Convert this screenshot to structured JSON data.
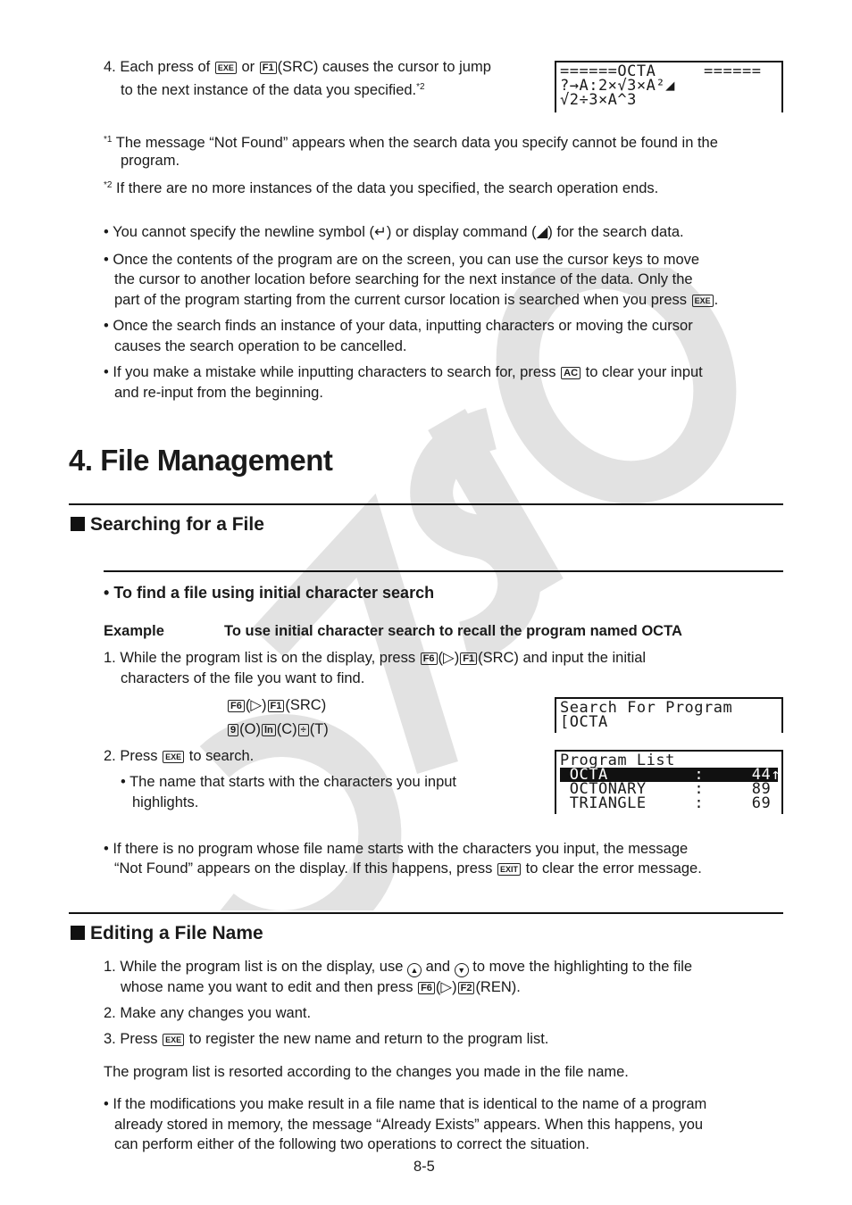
{
  "watermark": "CASIO",
  "top": {
    "step4": {
      "num": "4.",
      "pre": "Each press of",
      "key1": "EXE",
      "mid": "or",
      "key2": "F1",
      "post": "(SRC) causes the cursor to jump",
      "line2": "to the next instance of the data you specified.",
      "sup": "*2"
    },
    "screen1": {
      "rows": [
        "======OCTA     ======",
        "?→A:2×√3×A²◢",
        "√2÷3×A^3"
      ]
    },
    "footnotes": [
      {
        "mark": "*1",
        "line1": "The message “Not Found” appears when the search data you specify cannot be found in the",
        "line2": "program."
      },
      {
        "mark": "*2",
        "line1": "If there are no more instances of the data you specified, the search operation ends."
      }
    ],
    "bullets": [
      {
        "line1_pre": "You cannot specify the newline symbol (",
        "sym1": "↵",
        "line1_mid": ") or display command (",
        "sym2": "◢",
        "line1_post": ") for the search data."
      },
      {
        "line1": "Once the contents of the program are on the screen, you can use the cursor keys to move",
        "line2": "the cursor to another location before searching for the next instance of the data. Only the",
        "line3_pre": "part of the program starting from the current cursor location is searched when you press",
        "key": "EXE",
        "line3_post": "."
      },
      {
        "line1": "Once the search finds an instance of your data, inputting characters or moving the cursor",
        "line2": "causes the search operation to be cancelled."
      },
      {
        "line1_pre": "If you make a mistake while inputting characters to search for, press",
        "key": "AC",
        "line1_post": "to clear your input",
        "line2": "and re-input from the beginning."
      }
    ]
  },
  "section": {
    "title": "4. File Management",
    "searching": {
      "heading": "Searching for a File",
      "subheading": "To find a file using initial character search",
      "example_label": "Example",
      "example_text": "To use initial character search to recall the program named OCTA",
      "step1": {
        "num": "1.",
        "pre": "While the program list is on the display, press",
        "k1": "F6",
        "arrow": "(▷)",
        "k2": "F1",
        "post": "(SRC) and input the initial",
        "line2": "characters of the file you want to find."
      },
      "keyseq1": {
        "k1": "F6",
        "arrow": "(▷)",
        "k2": "F1",
        "label": "(SRC)"
      },
      "keyseq2": {
        "k1": "9",
        "l1": "(O)",
        "k2": "ln",
        "l2": "(C)",
        "k3": "÷",
        "l3": "(T)"
      },
      "screen2": {
        "rows": [
          "Search For Program",
          "[OCTA"
        ]
      },
      "step2": {
        "num": "2.",
        "pre": "Press",
        "key": "EXE",
        "post": "to search.",
        "sub1": "The name that starts with the characters you input",
        "sub2": "highlights."
      },
      "screen3": {
        "title": "Program List",
        "items": [
          {
            "name": "OCTA",
            "size": "44",
            "highlighted": true,
            "marker": "↑"
          },
          {
            "name": "OCTONARY",
            "size": "89",
            "highlighted": false
          },
          {
            "name": "TRIANGLE",
            "size": "69",
            "highlighted": false
          }
        ]
      },
      "note": {
        "line1": "If there is no program whose file name starts with the characters you input, the message",
        "line2_pre": "“Not Found” appears on the display. If this happens, press",
        "key": "EXIT",
        "line2_post": "to clear the error message."
      }
    },
    "editing": {
      "heading": "Editing a File Name",
      "step1": {
        "num": "1.",
        "pre": "While the program list is on the display, use",
        "up": "▲",
        "and": "and",
        "down": "▼",
        "post": "to move the highlighting to the file",
        "line2_pre": "whose name you want to edit and then press",
        "k1": "F6",
        "arrow": "(▷)",
        "k2": "F2",
        "line2_post": "(REN)."
      },
      "step2": {
        "num": "2.",
        "text": "Make any changes you want."
      },
      "step3": {
        "num": "3.",
        "pre": "Press",
        "key": "EXE",
        "post": "to register the new name and return to the program list."
      },
      "para": "The program list is resorted according to the changes you made in the file name.",
      "bullet": {
        "line1": "If the modifications you make result in a file name that is identical to the name of a program",
        "line2": "already stored in memory, the message “Already Exists” appears. When this happens, you",
        "line3": "can perform either of the following two operations to correct the situation."
      }
    }
  },
  "page_number": "8-5"
}
